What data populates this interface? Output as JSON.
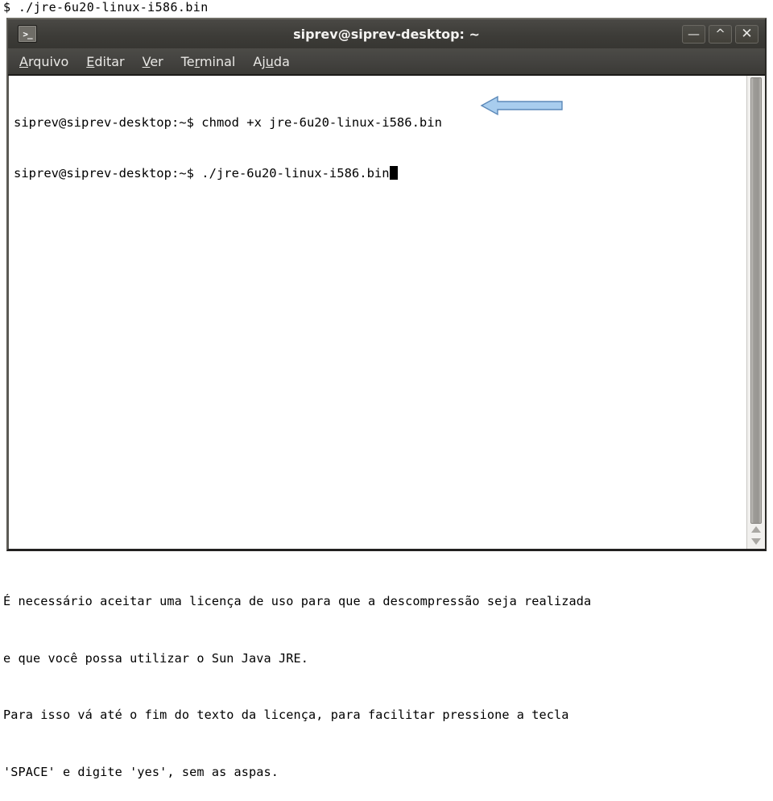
{
  "document": {
    "header_line": "$ ./jre-6u20-linux-i586.bin"
  },
  "window": {
    "title": "siprev@siprev-desktop: ~",
    "icon": "terminal-icon",
    "icon_glyph": ">_",
    "controls": {
      "minimize": "—",
      "maximize": "^",
      "close": "✕"
    },
    "colors": {
      "titlebar": "#3f3e3a",
      "menubar": "#44433f",
      "terminal_background": "#ffffff",
      "terminal_text": "#000000",
      "scrollbar_thumb": "#9d9b97",
      "annotation_arrow": "#a8cdee",
      "annotation_arrow_outline": "#5b88b8",
      "corner_accent": "#8a4a22"
    }
  },
  "menu": {
    "items": [
      {
        "name": "arquivo",
        "pre": "",
        "mnemonic": "A",
        "post": "rquivo"
      },
      {
        "name": "editar",
        "pre": "",
        "mnemonic": "E",
        "post": "ditar"
      },
      {
        "name": "ver",
        "pre": "",
        "mnemonic": "V",
        "post": "er"
      },
      {
        "name": "terminal",
        "pre": "Te",
        "mnemonic": "r",
        "post": "minal"
      },
      {
        "name": "ajuda",
        "pre": "Aj",
        "mnemonic": "u",
        "post": "da"
      }
    ]
  },
  "terminal": {
    "lines": [
      {
        "prompt": "siprev@siprev-desktop:~$ ",
        "command": "chmod +x jre-6u20-linux-i586.bin",
        "cursor": false
      },
      {
        "prompt": "siprev@siprev-desktop:~$ ",
        "command": "./jre-6u20-linux-i586.bin",
        "cursor": true
      }
    ]
  },
  "scrollbar": {
    "up_arrow": "scroll-up-arrow",
    "down_arrow": "scroll-down-arrow"
  },
  "annotation": {
    "type": "left-pointing-arrow",
    "points_to": "terminal-cursor"
  },
  "caption": {
    "lines": [
      "É necessário aceitar uma licença de uso para que a descompressão seja realizada",
      "e que você possa utilizar o Sun Java JRE.",
      "Para isso vá até o fim do texto da licença, para facilitar pressione a tecla",
      "'SPACE' e digite 'yes', sem as aspas."
    ]
  }
}
